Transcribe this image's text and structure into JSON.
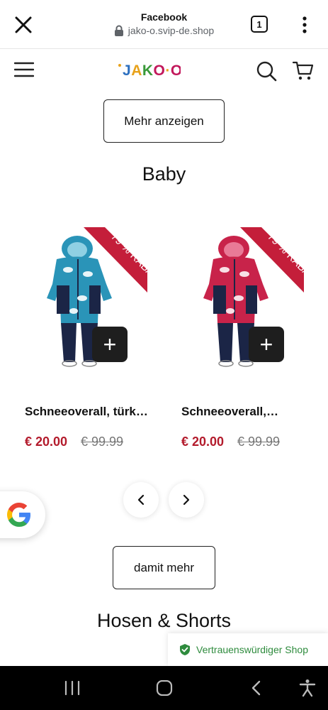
{
  "browser": {
    "title": "Facebook",
    "url": "jako-o.svip-de.shop",
    "tab_count": "1"
  },
  "header": {
    "logo": "JAKO-O"
  },
  "buttons": {
    "show_more": "Mehr anzeigen",
    "more": "damit mehr"
  },
  "sections": {
    "baby": "Baby",
    "pants": "Hosen & Shorts"
  },
  "products": [
    {
      "name": "Schneeoverall, türk…",
      "price": "€ 20.00",
      "old_price": "€ 99.99",
      "ribbon": "79 % RABATT",
      "color": "#2a94b8"
    },
    {
      "name": "Schneeoverall,…",
      "price": "€ 20.00",
      "old_price": "€ 99.99",
      "ribbon": "79 % RABATT",
      "color": "#c8234a"
    }
  ],
  "trust_badge": {
    "label": "Vertrauenswürdiger Shop"
  },
  "colors": {
    "price": "#b31b2c",
    "ribbon": "#c41e3a",
    "trust": "#2e8b3d"
  }
}
